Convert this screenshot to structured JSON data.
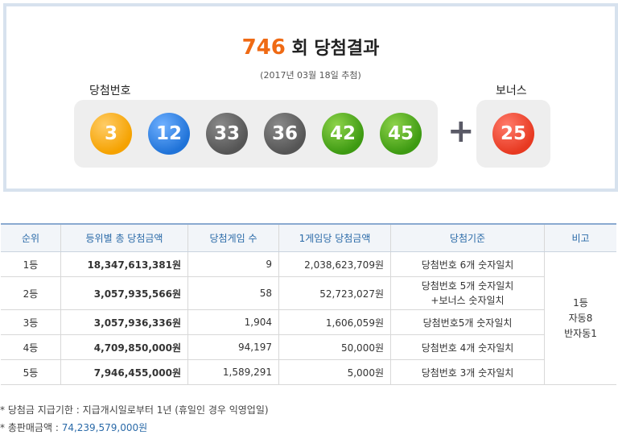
{
  "draw": {
    "round": "746",
    "title_suffix": " 회 당첨결과",
    "date": "(2017년 03월 18일 추첨)"
  },
  "labels": {
    "winning": "당첨번호",
    "bonus": "보너스",
    "plus": "+"
  },
  "winning_numbers": [
    {
      "value": "3",
      "color": "#f5a200"
    },
    {
      "value": "12",
      "color": "#2073d8"
    },
    {
      "value": "33",
      "color": "#555555"
    },
    {
      "value": "36",
      "color": "#555555"
    },
    {
      "value": "42",
      "color": "#3d9a12"
    },
    {
      "value": "45",
      "color": "#3d9a12"
    }
  ],
  "bonus_number": {
    "value": "25",
    "color": "#e73921"
  },
  "table": {
    "headers": [
      "순위",
      "등위별 총 당첨금액",
      "당첨게임 수",
      "1게임당 당첨금액",
      "당첨기준",
      "비고"
    ],
    "rows": [
      {
        "rank": "1등",
        "total": "18,347,613,381원",
        "games": "9",
        "per_game": "2,038,623,709원",
        "criteria": [
          "당첨번호 6개 숫자일치"
        ]
      },
      {
        "rank": "2등",
        "total": "3,057,935,566원",
        "games": "58",
        "per_game": "52,723,027원",
        "criteria": [
          "당첨번호 5개 숫자일치",
          "+보너스 숫자일치"
        ]
      },
      {
        "rank": "3등",
        "total": "3,057,936,336원",
        "games": "1,904",
        "per_game": "1,606,059원",
        "criteria": [
          "당첨번호5개 숫자일치"
        ]
      },
      {
        "rank": "4등",
        "total": "4,709,850,000원",
        "games": "94,197",
        "per_game": "50,000원",
        "criteria": [
          "당첨번호 4개 숫자일치"
        ]
      },
      {
        "rank": "5등",
        "total": "7,946,455,000원",
        "games": "1,589,291",
        "per_game": "5,000원",
        "criteria": [
          "당첨번호 3개 숫자일치"
        ]
      }
    ],
    "remarks": [
      "1등",
      "자동8",
      "반자동1"
    ]
  },
  "notes": {
    "deadline": "* 당첨금 지급기한 : 지급개시일로부터 1년 (휴일인 경우 익영업일)",
    "sales_label": "* 총판매금액 : ",
    "sales_value": "74,239,579,000원"
  }
}
